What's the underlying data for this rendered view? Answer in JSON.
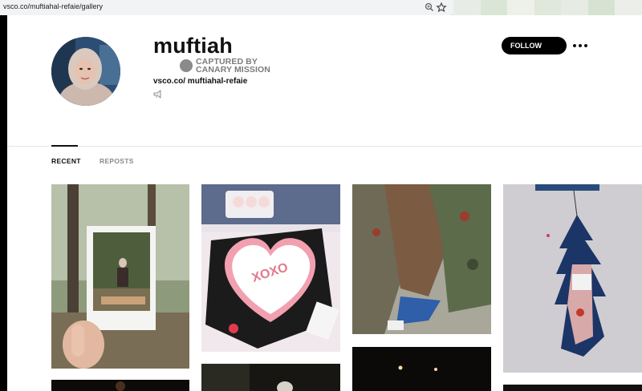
{
  "browser": {
    "url": "vsco.co/muftiahal-refaie/gallery",
    "zoom_icon": "zoom-icon",
    "star_icon": "bookmark-star-icon"
  },
  "profile": {
    "username": "muftiah",
    "stamp_line1": "CAPTURED BY",
    "stamp_line2": "CANARY MISSION",
    "url": "vsco.co/ muftiahal-refaie",
    "emoji_icon": "megaphone-icon"
  },
  "actions": {
    "follow_label": "FOLLOW",
    "more_icon": "more-horizontal-icon"
  },
  "tabs": [
    {
      "label": "RECENT",
      "active": true
    },
    {
      "label": "REPOSTS",
      "active": false
    }
  ],
  "gallery": {
    "photos": [
      {
        "name": "photo-polaroid-picnic"
      },
      {
        "name": "photo-xoxo-heart-cake"
      },
      {
        "name": "photo-camo-jacket-hijab"
      },
      {
        "name": "photo-car-air-freshener"
      },
      {
        "name": "photo-dark-night-1"
      },
      {
        "name": "photo-dark-night-2"
      },
      {
        "name": "photo-dark-night-3"
      },
      {
        "name": "photo-dark-night-4"
      }
    ]
  },
  "colors": {
    "accent": "#000000",
    "tab_inactive": "#8a8a8a",
    "stamp": "#7b7b7b"
  }
}
